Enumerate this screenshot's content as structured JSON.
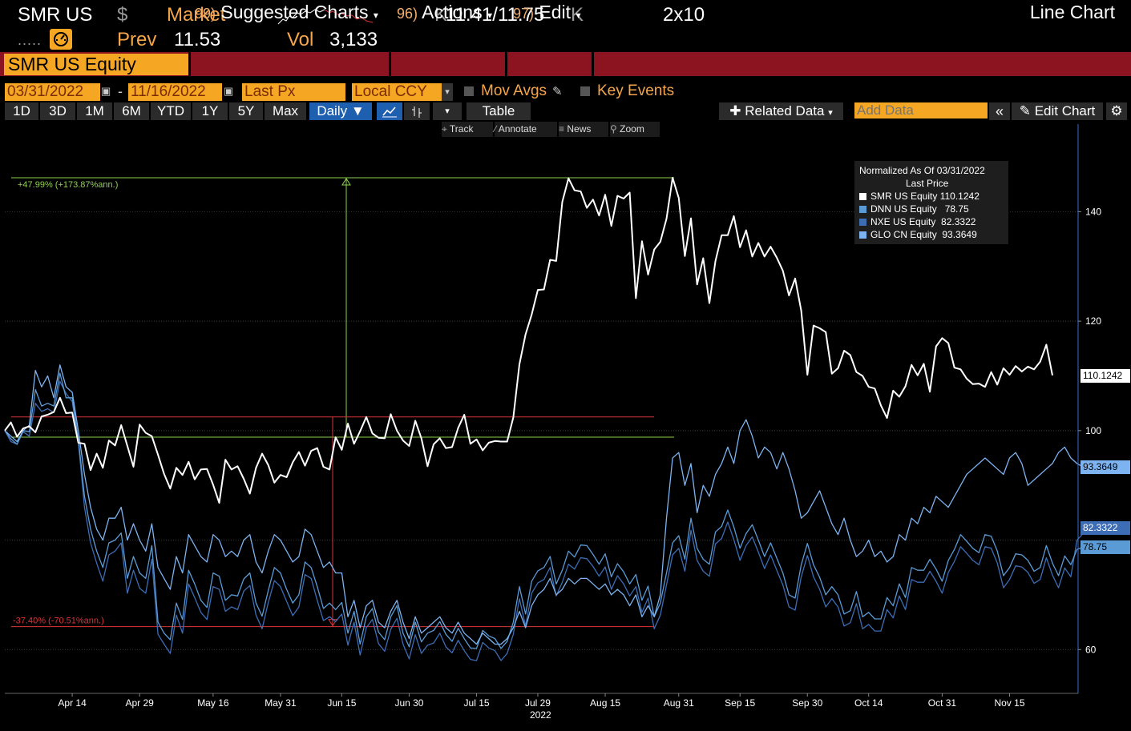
{
  "header": {
    "ticker": "SMR US",
    "currency_symbol": "$",
    "market_label": "Market",
    "prev_label": "Prev",
    "prev_value": "11.53",
    "vol_label": "Vol",
    "vol_value": "3,133",
    "quote": "11.41/11.75",
    "quote_prefix": "K",
    "quote_suffix": "K",
    "size": "2x10",
    "dots": "....."
  },
  "menu": {
    "security": "SMR US Equity",
    "suggested_num": "99)",
    "suggested_label": "Suggested Charts",
    "actions_num": "96)",
    "actions_label": "Actions",
    "edit_num": "97)",
    "edit_label": "Edit",
    "chart_type": "Line Chart"
  },
  "settings": {
    "start_date": "03/31/2022",
    "end_date": "11/16/2022",
    "field": "Last Px",
    "currency": "Local CCY",
    "mov_avgs": "Mov Avgs",
    "key_events": "Key Events"
  },
  "toolbar": {
    "periods": [
      "1D",
      "3D",
      "1M",
      "6M",
      "YTD",
      "1Y",
      "5Y",
      "Max"
    ],
    "frequency": "Daily",
    "table": "Table",
    "related_data": "Related Data",
    "add_data_placeholder": "Add Data",
    "edit_chart": "Edit Chart"
  },
  "tools": {
    "track": "Track",
    "annotate": "Annotate",
    "news": "News",
    "zoom": "Zoom"
  },
  "colors": {
    "orange": "#f5a623",
    "menu_red": "#8b1420",
    "green_annot": "#8fd14f",
    "red_annot": "#d9343a"
  },
  "chart_data": {
    "type": "line",
    "legend": {
      "title": "Normalized As Of 03/31/2022",
      "subtitle": "Last Price",
      "placement": "top-right"
    },
    "x_ticks": [
      "Apr 14",
      "Apr 29",
      "May 16",
      "May 31",
      "Jun 15",
      "Jun 30",
      "Jul 15",
      "Jul 29",
      "Aug 15",
      "Aug 31",
      "Sep 15",
      "Sep 30",
      "Oct 14",
      "Oct 31",
      "Nov 15"
    ],
    "x_year": "2022",
    "ylim": [
      52,
      156
    ],
    "y_ticks": [
      60,
      100,
      120,
      140
    ],
    "grid": true,
    "annotations": [
      {
        "text": "+47.99% (+173.87%ann.)",
        "y_from": 98.8,
        "y_to": 146.2,
        "color": "#8fd14f"
      },
      {
        "text": "-37.40% (-70.51%ann.)",
        "y_from": 102.5,
        "y_to": 64.2,
        "color": "#d9343a"
      }
    ],
    "series": [
      {
        "name": "SMR US Equity",
        "last": "110.1242",
        "color": "#ffffff",
        "values": [
          100,
          101.5,
          98.9,
          100.4,
          100.8,
          99.7,
          102.6,
          102.9,
          103.4,
          106,
          103.2,
          103.3,
          97.8,
          97.6,
          92.8,
          95.8,
          93.2,
          98.2,
          97.3,
          101,
          97.2,
          93.4,
          101.1,
          99.6,
          99,
          95.6,
          92.1,
          89.4,
          93.2,
          91.9,
          94.3,
          91.1,
          92.9,
          93,
          90.1,
          86.8,
          94.7,
          92.9,
          93.5,
          91.2,
          88.5,
          93.2,
          95.8,
          93.7,
          90.5,
          91.9,
          91.5,
          94.2,
          96.1,
          93.6,
          96.3,
          96.8,
          93.4,
          92.9,
          98.8,
          96.5,
          101.3,
          97.6,
          99.9,
          102.5,
          99.5,
          98.7,
          98.6,
          103,
          100,
          98.2,
          97.2,
          101.8,
          98.6,
          93.5,
          97.5,
          98.6,
          96.8,
          97,
          100.5,
          102.9,
          97.6,
          98.4,
          96.4,
          97.8,
          98.1,
          98,
          98,
          102.4,
          112.1,
          117.6,
          121.2,
          125.7,
          125.8,
          131.2,
          131,
          141.8,
          146.1,
          143.9,
          143.7,
          140.7,
          142.2,
          139.3,
          143.1,
          137.4,
          142.9,
          142.4,
          143.5,
          124.2,
          134.6,
          128.5,
          133.1,
          134.5,
          138.7,
          146.2,
          142.5,
          131.9,
          138.8,
          126.7,
          131.5,
          123.3,
          131,
          135.7,
          135.7,
          139.2,
          133.5,
          136.6,
          131.8,
          134.3,
          131.8,
          133.6,
          131.6,
          129.2,
          124.7,
          127.8,
          121.9,
          110.2,
          119.2,
          118.7,
          118,
          110.4,
          111.4,
          114.6,
          113.8,
          110.7,
          110,
          108,
          107.7,
          104.6,
          102.3,
          107.3,
          106.2,
          108.1,
          112,
          110.1,
          112.2,
          107.1,
          115.4,
          116.9,
          116,
          111.5,
          111.2,
          109.5,
          108.5,
          108.6,
          108,
          110.7,
          108.4,
          111.4,
          110.2,
          111.8,
          110.8,
          111.7,
          111.2,
          112.6,
          115.7,
          110.1
        ]
      },
      {
        "name": "DNN US Equity",
        "last": "78.75",
        "color": "#5b9bd5",
        "values": [
          100,
          98.5,
          97.5,
          100,
          99.8,
          107.5,
          104.5,
          105,
          104.5,
          110.5,
          106,
          106,
          98.5,
          88,
          82,
          78,
          75,
          79.5,
          80,
          81.3,
          73,
          77,
          74,
          73,
          79,
          65,
          63,
          61.8,
          68.5,
          65.5,
          74.5,
          72,
          69,
          67.7,
          74,
          73.4,
          69,
          70,
          69.8,
          72.9,
          74,
          68.5,
          66.1,
          70.8,
          75,
          74,
          71,
          68.5,
          70,
          76,
          75,
          71.5,
          67.5,
          68.5,
          67.3,
          68.6,
          63,
          67,
          61,
          66,
          67.5,
          63.2,
          61.8,
          66,
          68,
          63,
          60.5,
          65,
          61.4,
          63,
          63.5,
          65.1,
          62.8,
          61.5,
          63.9,
          62,
          60.3,
          60.2,
          63.5,
          62.5,
          62,
          60.2,
          61.5,
          65,
          71.5,
          66.5,
          72.5,
          74.4,
          75,
          77,
          72,
          74.5,
          78,
          76.9,
          79.1,
          79,
          77.4,
          75.6,
          77.5,
          73.3,
          75.7,
          74.2,
          72,
          73.7,
          69,
          71.6,
          66,
          68.5,
          74,
          79.5,
          80.8,
          76.5,
          84,
          78.5,
          76.5,
          75.6,
          81.5,
          82.5,
          85.5,
          82.4,
          78.5,
          81.2,
          82.8,
          80,
          77,
          79.5,
          76.7,
          74,
          70,
          69.4,
          75.5,
          79.4,
          75.5,
          73.2,
          70,
          71.5,
          70,
          66.5,
          67.1,
          70.6,
          66,
          66.8,
          65.6,
          65.6,
          69.5,
          68,
          72,
          69.5,
          75,
          74.5,
          74.5,
          76.5,
          74.7,
          72.5,
          76.3,
          78.3,
          81,
          79.8,
          78.5,
          77.7,
          81,
          80.7,
          78,
          73.5,
          75,
          77.5,
          77.3,
          76.3,
          74.3,
          75,
          79,
          75.8,
          73.5,
          77.1,
          75.5,
          78.3,
          78.7,
          78.75
        ]
      },
      {
        "name": "NXE US Equity",
        "last": "82.3322",
        "color": "#3d6db5",
        "values": [
          100,
          98,
          97.5,
          99.8,
          99,
          105,
          103.5,
          104,
          103.3,
          109,
          106.8,
          105.3,
          98,
          86,
          79.5,
          75.8,
          72.5,
          77.3,
          78,
          79.5,
          70.3,
          74.5,
          71.2,
          70.3,
          76.5,
          62.8,
          61,
          59.3,
          66.3,
          63,
          72,
          69.5,
          66.8,
          65.5,
          71.5,
          71,
          67,
          67.8,
          67.3,
          70.7,
          71.7,
          66.3,
          63.8,
          68.6,
          72.6,
          71.5,
          68.8,
          66.2,
          67.8,
          73.7,
          73,
          69,
          65.3,
          66,
          65.1,
          66.5,
          60.8,
          65,
          59,
          64,
          65.5,
          61.1,
          59.7,
          63.7,
          65.7,
          61,
          58.3,
          62.7,
          59.3,
          60.8,
          61.2,
          63,
          60.5,
          59.4,
          61.7,
          59.8,
          58.2,
          58,
          61.3,
          60.3,
          59.8,
          58,
          59.3,
          62.8,
          69.3,
          64.3,
          70.3,
          72.2,
          72.8,
          75,
          69.8,
          72.3,
          75.6,
          74.7,
          76.8,
          76.6,
          75.2,
          73.4,
          75.1,
          71,
          73.5,
          72,
          69.8,
          71.5,
          66.8,
          69.4,
          63.8,
          66.3,
          71.8,
          77.3,
          78.5,
          74.3,
          81.8,
          76.3,
          74.3,
          73.4,
          79.3,
          80.3,
          83.3,
          80.1,
          76.3,
          79,
          80.6,
          77.8,
          74.8,
          77.3,
          74.5,
          71.8,
          67.8,
          67.2,
          73.3,
          77.2,
          73.3,
          71,
          67.8,
          69.3,
          67.8,
          64.3,
          64.9,
          68.4,
          63.8,
          64.6,
          63.4,
          63.4,
          67.3,
          65.8,
          69.8,
          67.3,
          72.8,
          72.3,
          72.3,
          74.3,
          72.5,
          70.3,
          74.1,
          76.1,
          78.8,
          77.6,
          76.3,
          75.5,
          78.8,
          78.5,
          75.8,
          71.3,
          72.8,
          75.3,
          75.1,
          74.1,
          72.1,
          72.8,
          76.8,
          73.6,
          71.3,
          74.9,
          73.3,
          80,
          81.2,
          82.3322
        ]
      },
      {
        "name": "GLO CN Equity",
        "last": "93.3649",
        "color": "#7db3f0",
        "values": [
          100,
          99,
          98,
          100,
          101,
          111,
          108,
          110,
          106,
          112,
          108,
          107,
          100,
          92,
          86,
          82,
          80,
          84,
          84,
          86,
          80,
          83,
          80,
          78,
          83,
          75,
          73,
          71,
          77,
          74,
          81,
          79,
          77,
          76,
          81,
          80,
          77,
          78,
          77,
          80,
          81,
          76,
          74,
          78,
          81,
          80,
          78,
          76,
          77,
          82,
          81,
          78,
          75,
          76,
          74,
          74,
          66,
          69,
          64,
          68,
          69,
          65,
          64,
          67,
          69,
          65,
          62,
          66,
          63,
          64,
          65,
          66,
          64,
          63,
          65,
          63,
          62,
          61,
          63,
          62,
          61,
          61,
          62,
          64,
          67,
          64,
          68,
          70,
          71,
          73,
          70,
          71,
          73,
          72,
          73,
          73,
          72,
          71,
          72,
          70,
          71,
          70,
          68,
          70,
          66,
          68,
          66,
          70,
          84,
          95,
          96,
          90,
          94,
          85,
          90,
          88,
          92,
          94,
          97,
          94,
          100,
          102,
          99,
          95,
          97,
          96,
          93,
          96,
          93,
          89,
          84,
          85,
          87,
          89,
          86,
          83,
          81,
          84,
          80,
          77,
          78,
          80,
          77,
          78,
          76,
          77,
          81,
          80,
          84,
          83,
          86,
          85,
          88,
          87,
          86,
          88,
          90,
          92,
          93,
          94,
          95,
          94,
          93,
          92,
          95,
          96,
          94,
          90,
          91,
          92,
          93,
          94,
          96,
          97,
          95,
          94,
          93.3649
        ]
      }
    ]
  }
}
